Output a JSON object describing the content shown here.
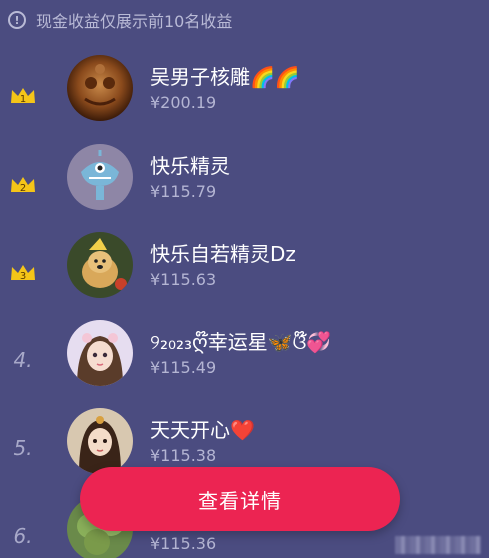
{
  "notice": {
    "icon": "info-icon",
    "text": "现金收益仅展示前10名收益"
  },
  "leaderboard": [
    {
      "rank": "1",
      "rank_style": "crown-gold",
      "avatar": "carved-wood-avatar",
      "name": "吴男子核雕🌈🌈",
      "amount": "¥200.19"
    },
    {
      "rank": "2",
      "rank_style": "crown-gold",
      "avatar": "monster-avatar",
      "name": "快乐精灵",
      "amount": "¥115.79"
    },
    {
      "rank": "3",
      "rank_style": "crown-gold",
      "avatar": "dog-avatar",
      "name": "快乐自若精灵Dz",
      "amount": "¥115.63"
    },
    {
      "rank": "4.",
      "rank_style": "number",
      "avatar": "girl-avatar",
      "name": "୨₂₀₂₃ღ໊幸运星🦋ଓ໊💞",
      "amount": "¥115.49"
    },
    {
      "rank": "5.",
      "rank_style": "number",
      "avatar": "princess-avatar",
      "name": "天天开心❤️",
      "amount": "¥115.38"
    },
    {
      "rank": "6.",
      "rank_style": "number",
      "avatar": "plant-avatar",
      "name": "",
      "amount": "¥115.36"
    }
  ],
  "cta": {
    "label": "查看详情"
  },
  "colors": {
    "background": "#4b4c80",
    "cta": "#ec2452",
    "crown": "#f5c518"
  }
}
